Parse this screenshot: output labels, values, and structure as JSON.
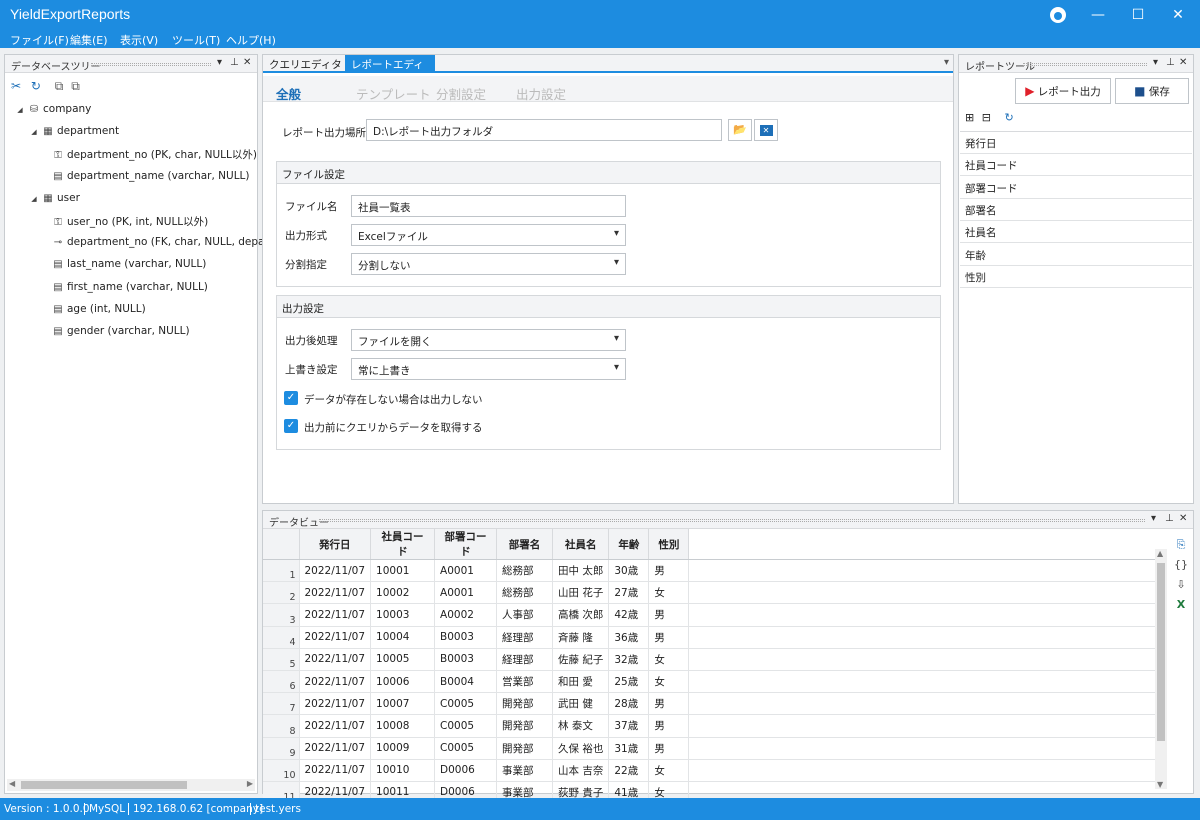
{
  "window": {
    "title": "YieldExportReports",
    "controls": [
      "—",
      "☐",
      "✕"
    ]
  },
  "menu": [
    "ファイル(F)",
    "編集(E)",
    "表示(V)",
    "ツール(T)",
    "ヘルプ(H)"
  ],
  "db_tree": {
    "title": "データベースツリー",
    "items": [
      {
        "label": "company",
        "icon": "database-icon",
        "level": 0
      },
      {
        "label": "department",
        "icon": "table-icon",
        "level": 1
      },
      {
        "label": "department_no (PK, char, NULL以外)",
        "icon": "key-icon",
        "level": 2
      },
      {
        "label": "department_name (varchar, NULL)",
        "icon": "column-icon",
        "level": 2
      },
      {
        "label": "user",
        "icon": "table-icon",
        "level": 1
      },
      {
        "label": "user_no (PK, int, NULL以外)",
        "icon": "key-icon",
        "level": 2
      },
      {
        "label": "department_no (FK, char, NULL, departme",
        "icon": "foreign-key-icon",
        "level": 2
      },
      {
        "label": "last_name (varchar, NULL)",
        "icon": "column-icon",
        "level": 2
      },
      {
        "label": "first_name (varchar, NULL)",
        "icon": "column-icon",
        "level": 2
      },
      {
        "label": "age (int, NULL)",
        "icon": "column-icon",
        "level": 2
      },
      {
        "label": "gender (varchar, NULL)",
        "icon": "column-icon",
        "level": 2
      }
    ]
  },
  "editor": {
    "tabs": [
      "クエリエディタ",
      "レポートエディタ"
    ],
    "subtabs": [
      "全般",
      "テンプレート",
      "分割設定",
      "出力設定"
    ],
    "output_location_label": "レポート出力場所",
    "output_location_value": "D:\\レポート出力フォルダ",
    "file_group": {
      "title": "ファイル設定",
      "name_label": "ファイル名",
      "name_value": "社員一覧表",
      "format_label": "出力形式",
      "format_value": "Excelファイル",
      "split_label": "分割指定",
      "split_value": "分割しない"
    },
    "output_group": {
      "title": "出力設定",
      "post_label": "出力後処理",
      "post_value": "ファイルを開く",
      "overwrite_label": "上書き設定",
      "overwrite_value": "常に上書き",
      "check1": "データが存在しない場合は出力しない",
      "check2": "出力前にクエリからデータを取得する",
      "check1_checked": true,
      "check2_checked": true
    }
  },
  "report_tool": {
    "title": "レポートツール",
    "output_button": "レポート出力",
    "save_button": "保存",
    "fields": [
      "発行日",
      "社員コード",
      "部署コード",
      "部署名",
      "社員名",
      "年齢",
      "性別"
    ]
  },
  "data_view": {
    "title": "データビュー",
    "columns": [
      "発行日",
      "社員コード",
      "部署コード",
      "部署名",
      "社員名",
      "年齢",
      "性別"
    ],
    "rows": [
      [
        "1",
        "2022/11/07",
        "10001",
        "A0001",
        "総務部",
        "田中 太郎",
        "30歳",
        "男"
      ],
      [
        "2",
        "2022/11/07",
        "10002",
        "A0001",
        "総務部",
        "山田 花子",
        "27歳",
        "女"
      ],
      [
        "3",
        "2022/11/07",
        "10003",
        "A0002",
        "人事部",
        "高橋 次郎",
        "42歳",
        "男"
      ],
      [
        "4",
        "2022/11/07",
        "10004",
        "B0003",
        "経理部",
        "斉藤 隆",
        "36歳",
        "男"
      ],
      [
        "5",
        "2022/11/07",
        "10005",
        "B0003",
        "経理部",
        "佐藤 紀子",
        "32歳",
        "女"
      ],
      [
        "6",
        "2022/11/07",
        "10006",
        "B0004",
        "営業部",
        "和田 愛",
        "25歳",
        "女"
      ],
      [
        "7",
        "2022/11/07",
        "10007",
        "C0005",
        "開発部",
        "武田 健",
        "28歳",
        "男"
      ],
      [
        "8",
        "2022/11/07",
        "10008",
        "C0005",
        "開発部",
        "林 泰文",
        "37歳",
        "男"
      ],
      [
        "9",
        "2022/11/07",
        "10009",
        "C0005",
        "開発部",
        "久保 裕也",
        "31歳",
        "男"
      ],
      [
        "10",
        "2022/11/07",
        "10010",
        "D0006",
        "事業部",
        "山本 吉奈",
        "22歳",
        "女"
      ],
      [
        "11",
        "2022/11/07",
        "10011",
        "D0006",
        "事業部",
        "荻野 貴子",
        "41歳",
        "女"
      ]
    ]
  },
  "status": {
    "version": "Version : 1.0.0.0",
    "db": "MySQL",
    "host": "192.168.0.62 [company]",
    "file": "test.yers"
  },
  "colors": {
    "accent": "#1d8ce0",
    "run": "#e0202a",
    "excel": "#1e7a3c"
  }
}
